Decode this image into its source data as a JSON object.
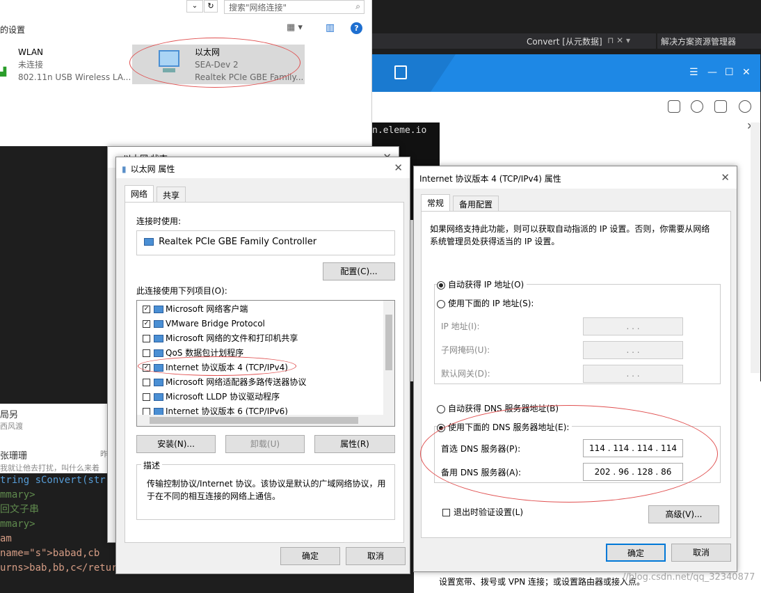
{
  "netwin": {
    "search_placeholder": "搜索\"网络连接\"",
    "settings_label": "的设置",
    "wlan": {
      "name": "WLAN",
      "status": "未连接",
      "device": "802.11n USB Wireless LA..."
    },
    "ethernet": {
      "name": "以太网",
      "network": "SEA-Dev  2",
      "device": "Realtek PCIe GBE Family..."
    }
  },
  "vsbar": {
    "convert_tab": "Convert [从元数据]",
    "solution_explorer": "解决方案资源管理器"
  },
  "blueapp": {
    "terminal_text": "n.eleme.io"
  },
  "background_left": {
    "line1": "局另",
    "line2": "西风渡",
    "line3": "张珊珊",
    "line4": "昨",
    "line5": "我就让他去打扰，叫什么来着",
    "code": [
      "tring sConvert(str",
      "mmary>",
      "回文子串",
      "mmary>",
      "am name=\"s\">babad,cb",
      "urns>bab,bb,c</retur"
    ]
  },
  "status_bottom": "设置宽带、拨号或 VPN 连接；或设置路由器或接入点。",
  "watermark": "//blog.csdn.net/qq_32340877",
  "eth_status_title": "以太网 状态",
  "eth_props": {
    "title": "以太网 属性",
    "tabs": [
      "网络",
      "共享"
    ],
    "connect_using_label": "连接时使用:",
    "adapter": "Realtek PCIe GBE Family Controller",
    "configure_btn": "配置(C)...",
    "items_label": "此连接使用下列项目(O):",
    "items": [
      {
        "label": "Microsoft 网络客户端",
        "checked": true
      },
      {
        "label": "VMware Bridge Protocol",
        "checked": true
      },
      {
        "label": "Microsoft 网络的文件和打印机共享",
        "checked": false
      },
      {
        "label": "QoS 数据包计划程序",
        "checked": false
      },
      {
        "label": "Internet 协议版本 4 (TCP/IPv4)",
        "checked": true
      },
      {
        "label": "Microsoft 网络适配器多路传送器协议",
        "checked": false
      },
      {
        "label": "Microsoft LLDP 协议驱动程序",
        "checked": false
      },
      {
        "label": "Internet 协议版本 6 (TCP/IPv6)",
        "checked": false
      }
    ],
    "install_btn": "安装(N)...",
    "uninstall_btn": "卸载(U)",
    "properties_btn": "属性(R)",
    "desc_title": "描述",
    "desc_text": "传输控制协议/Internet 协议。该协议是默认的广域网络协议，用于在不同的相互连接的网络上通信。",
    "ok_btn": "确定",
    "cancel_btn": "取消"
  },
  "ipv4": {
    "title": "Internet 协议版本 4 (TCP/IPv4) 属性",
    "tabs": [
      "常规",
      "备用配置"
    ],
    "intro": "如果网络支持此功能，则可以获取自动指派的 IP 设置。否则，你需要从网络系统管理员处获得适当的 IP 设置。",
    "auto_ip": "自动获得 IP 地址(O)",
    "manual_ip": "使用下面的 IP 地址(S):",
    "ip_label": "IP 地址(I):",
    "mask_label": "子网掩码(U):",
    "gateway_label": "默认网关(D):",
    "empty_ip": ".   .   .",
    "auto_dns": "自动获得 DNS 服务器地址(B)",
    "manual_dns": "使用下面的 DNS 服务器地址(E):",
    "pref_dns_label": "首选 DNS 服务器(P):",
    "pref_dns": "114 . 114 . 114 . 114",
    "alt_dns_label": "备用 DNS 服务器(A):",
    "alt_dns": "202 . 96  . 128 . 86",
    "validate": "退出时验证设置(L)",
    "advanced_btn": "高级(V)...",
    "ok_btn": "确定",
    "cancel_btn": "取消"
  }
}
